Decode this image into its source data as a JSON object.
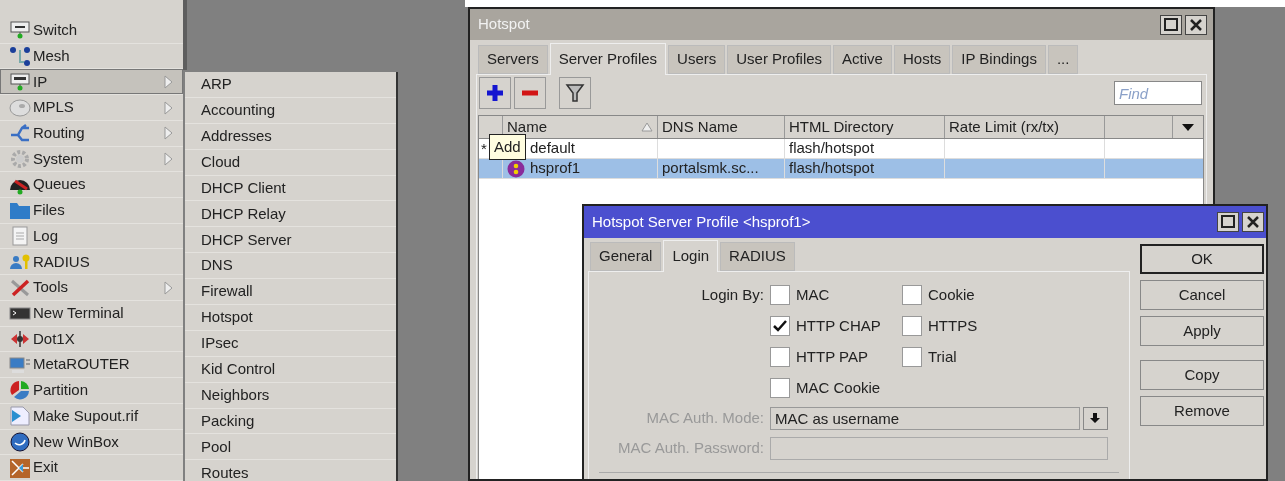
{
  "main_menu": {
    "items": [
      {
        "label": "Switch",
        "has_submenu": false,
        "selected": false
      },
      {
        "label": "Mesh",
        "has_submenu": false,
        "selected": false
      },
      {
        "label": "IP",
        "has_submenu": true,
        "selected": true
      },
      {
        "label": "MPLS",
        "has_submenu": true,
        "selected": false
      },
      {
        "label": "Routing",
        "has_submenu": true,
        "selected": false
      },
      {
        "label": "System",
        "has_submenu": true,
        "selected": false
      },
      {
        "label": "Queues",
        "has_submenu": false,
        "selected": false
      },
      {
        "label": "Files",
        "has_submenu": false,
        "selected": false
      },
      {
        "label": "Log",
        "has_submenu": false,
        "selected": false
      },
      {
        "label": "RADIUS",
        "has_submenu": false,
        "selected": false
      },
      {
        "label": "Tools",
        "has_submenu": true,
        "selected": false
      },
      {
        "label": "New Terminal",
        "has_submenu": false,
        "selected": false
      },
      {
        "label": "Dot1X",
        "has_submenu": false,
        "selected": false
      },
      {
        "label": "MetaROUTER",
        "has_submenu": false,
        "selected": false
      },
      {
        "label": "Partition",
        "has_submenu": false,
        "selected": false
      },
      {
        "label": "Make Supout.rif",
        "has_submenu": false,
        "selected": false
      },
      {
        "label": "New WinBox",
        "has_submenu": false,
        "selected": false
      },
      {
        "label": "Exit",
        "has_submenu": false,
        "selected": false
      }
    ]
  },
  "submenu": {
    "items": [
      "ARP",
      "Accounting",
      "Addresses",
      "Cloud",
      "DHCP Client",
      "DHCP Relay",
      "DHCP Server",
      "DNS",
      "Firewall",
      "Hotspot",
      "IPsec",
      "Kid Control",
      "Neighbors",
      "Packing",
      "Pool",
      "Routes"
    ]
  },
  "hotspot_window": {
    "title": "Hotspot",
    "tabs": [
      {
        "label": "Servers",
        "selected": false
      },
      {
        "label": "Server Profiles",
        "selected": true
      },
      {
        "label": "Users",
        "selected": false
      },
      {
        "label": "User Profiles",
        "selected": false
      },
      {
        "label": "Active",
        "selected": false
      },
      {
        "label": "Hosts",
        "selected": false
      },
      {
        "label": "IP Bindings",
        "selected": false
      },
      {
        "label": "...",
        "selected": false
      }
    ],
    "find": {
      "placeholder": "Find"
    },
    "tooltip": "Add",
    "table": {
      "columns": [
        "Name",
        "DNS Name",
        "HTML Directory",
        "Rate Limit (rx/tx)"
      ],
      "rows": [
        {
          "marker": "*",
          "name": "default",
          "html_directory": "flash/hotspot",
          "selected": false
        },
        {
          "name": "hsprof1",
          "dns_name": "portalsmk.sc...",
          "html_directory": "flash/hotspot",
          "selected": true
        }
      ]
    }
  },
  "dialog": {
    "title": "Hotspot Server Profile <hsprof1>",
    "tabs": [
      {
        "label": "General",
        "selected": false
      },
      {
        "label": "Login",
        "selected": true
      },
      {
        "label": "RADIUS",
        "selected": false
      }
    ],
    "login_by_label": "Login By:",
    "options": [
      {
        "label": "MAC",
        "checked": false
      },
      {
        "label": "Cookie",
        "checked": false
      },
      {
        "label": "HTTP CHAP",
        "checked": true
      },
      {
        "label": "HTTPS",
        "checked": false
      },
      {
        "label": "HTTP PAP",
        "checked": false
      },
      {
        "label": "Trial",
        "checked": false
      },
      {
        "label": "MAC Cookie",
        "checked": false
      }
    ],
    "fields": [
      {
        "label": "MAC Auth. Mode:",
        "value": "MAC as username",
        "kind": "dropdown",
        "disabled": true
      },
      {
        "label": "MAC Auth. Password:",
        "kind": "text",
        "disabled": true
      }
    ],
    "buttons": [
      "OK",
      "Cancel",
      "Apply",
      "Copy",
      "Remove"
    ]
  }
}
